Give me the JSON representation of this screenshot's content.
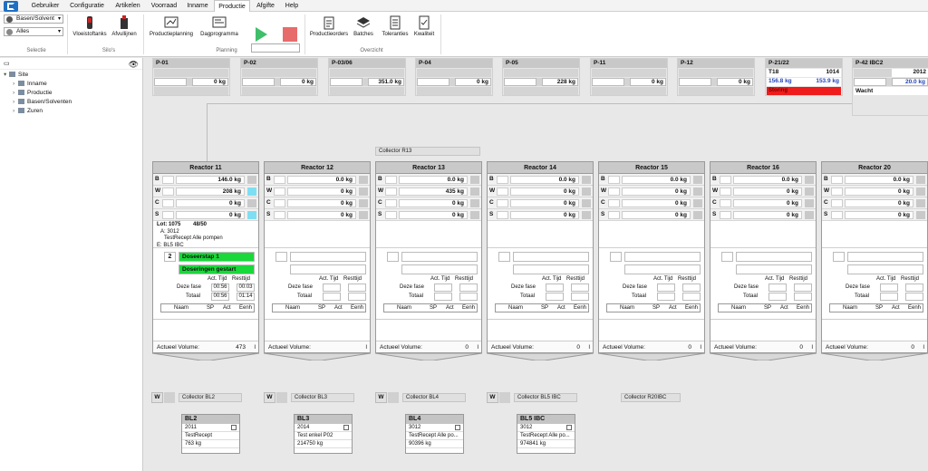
{
  "menu": {
    "items": [
      "Gebruiker",
      "Configuratie",
      "Artikelen",
      "Voorraad",
      "Inname",
      "Productie",
      "Afgifte",
      "Help"
    ],
    "active": "Productie"
  },
  "ribbon": {
    "selectie": {
      "select1": "Basen/Solvent",
      "select2": "Alles",
      "label": "Selectie"
    },
    "silos": {
      "btn1": "Vloeistoftanks",
      "btn2": "Afvullijnen",
      "label": "Silo's"
    },
    "planning": {
      "btn1": "Productieplanning",
      "btn2": "Dagprogramma",
      "label": "Planning"
    },
    "overzicht": {
      "btn1": "Productieorders",
      "btn2": "Batches",
      "btn3": "Toleranties",
      "btn4": "Kwaliteit",
      "label": "Overzicht"
    }
  },
  "tree": {
    "root": "Site",
    "items": [
      "Inname",
      "Productie",
      "Basen/Solventen",
      "Zuren"
    ]
  },
  "tanks": [
    {
      "name": "P-01",
      "value": "0 kg"
    },
    {
      "name": "P-02",
      "value": "0 kg"
    },
    {
      "name": "P-03/06",
      "value": "351.0 kg"
    },
    {
      "name": "P-04",
      "value": "0 kg"
    },
    {
      "name": "P-05",
      "value": "228 kg"
    },
    {
      "name": "P-11",
      "value": "0 kg"
    },
    {
      "name": "P-12",
      "value": "0 kg"
    }
  ],
  "tank_p21": {
    "name": "P-21/22",
    "id": "T18",
    "num": "1014",
    "v1": "156.8 kg",
    "v2": "153.9 kg",
    "status": "Storing"
  },
  "tank_p42": {
    "name": "P-42 IBC2",
    "num": "2012",
    "value": "20.0 kg",
    "status": "Wacht"
  },
  "collector_r13": "Collector R13",
  "reactors": [
    {
      "name": "Reactor 11",
      "b": "146.0 kg",
      "w": "208 kg",
      "c": "0 kg",
      "s": "0 kg",
      "volume": "473"
    },
    {
      "name": "Reactor 12",
      "b": "0.0 kg",
      "w": "0 kg",
      "c": "0 kg",
      "s": "0 kg",
      "volume": ""
    },
    {
      "name": "Reactor 13",
      "b": "0.0 kg",
      "w": "435 kg",
      "c": "0 kg",
      "s": "0 kg",
      "volume": "0"
    },
    {
      "name": "Reactor 14",
      "b": "0.0 kg",
      "w": "0 kg",
      "c": "0 kg",
      "s": "0 kg",
      "volume": "0"
    },
    {
      "name": "Reactor 15",
      "b": "0.0 kg",
      "w": "0 kg",
      "c": "0 kg",
      "s": "0 kg",
      "volume": "0"
    },
    {
      "name": "Reactor 16",
      "b": "0.0 kg",
      "w": "0 kg",
      "c": "0 kg",
      "s": "0 kg",
      "volume": "0"
    },
    {
      "name": "Reactor 20",
      "b": "0.0 kg",
      "w": "0 kg",
      "c": "0 kg",
      "s": "0 kg",
      "volume": "0"
    }
  ],
  "reactor11": {
    "lot_label": "Lot:",
    "lot": "1075",
    "lot_count": "48/50",
    "a": "A: 3012",
    "recipe": "TestRecept Alle pompen",
    "e": "E: BL5 IBC",
    "step_num": "2",
    "step_name": "Doseerstap 1",
    "step_status": "Doseringen gestart",
    "deze_act": "00:56",
    "deze_rest": "00:03",
    "totaal_act": "00:56",
    "totaal_rest": "01:14"
  },
  "labels": {
    "row_b": "B",
    "row_w": "W",
    "row_c": "C",
    "row_s": "S",
    "act_tijd": "Act. Tijd",
    "resttijd": "Resttijd",
    "deze_fase": "Deze fase",
    "totaal": "Totaal",
    "naam": "Naam",
    "sp": "SP",
    "act": "Act",
    "eenh": "Eenh",
    "volume": "Actueel Volume:",
    "volume_unit": "l",
    "w": "W"
  },
  "collectors": [
    "Collector BL2",
    "Collector BL3",
    "Collector BL4",
    "Collector BL5 IBC",
    "Collector R20IBC"
  ],
  "bl_boxes": [
    {
      "name": "BL2",
      "num": "2011",
      "recipe": "TestRecept",
      "kg": "763 kg"
    },
    {
      "name": "BL3",
      "num": "2014",
      "recipe": "Test enkel P02",
      "kg": "214750 kg"
    },
    {
      "name": "BL4",
      "num": "3012",
      "recipe": "TestRecept Alle po...",
      "kg": "90396 kg"
    },
    {
      "name": "BL5 IBC",
      "num": "3012",
      "recipe": "TestRecept Alle po...",
      "kg": "974841 kg"
    }
  ],
  "colors": {
    "green": "#19d83a",
    "red": "#ee1c1c",
    "cyan": "#7fdff2",
    "accent": "#1f6fc3"
  }
}
